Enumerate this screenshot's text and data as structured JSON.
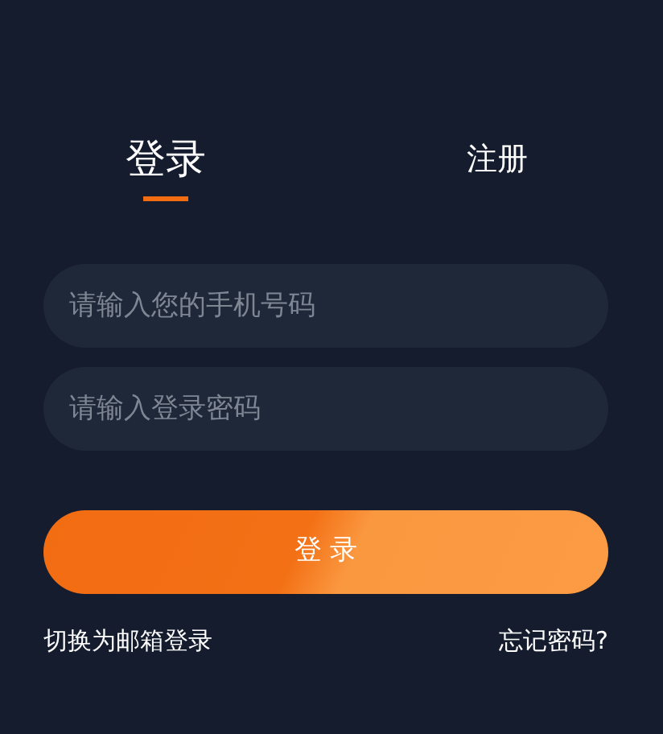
{
  "tabs": [
    {
      "label": "登录",
      "selected": true
    },
    {
      "label": "注册",
      "selected": false
    }
  ],
  "phone_field": {
    "placeholder": "请输入您的手机号码"
  },
  "password_field": {
    "placeholder": "请输入登录密码"
  },
  "submit_button": "登 录",
  "links": {
    "switch": "切换为邮箱登录",
    "forgot": "忘记密码?"
  }
}
